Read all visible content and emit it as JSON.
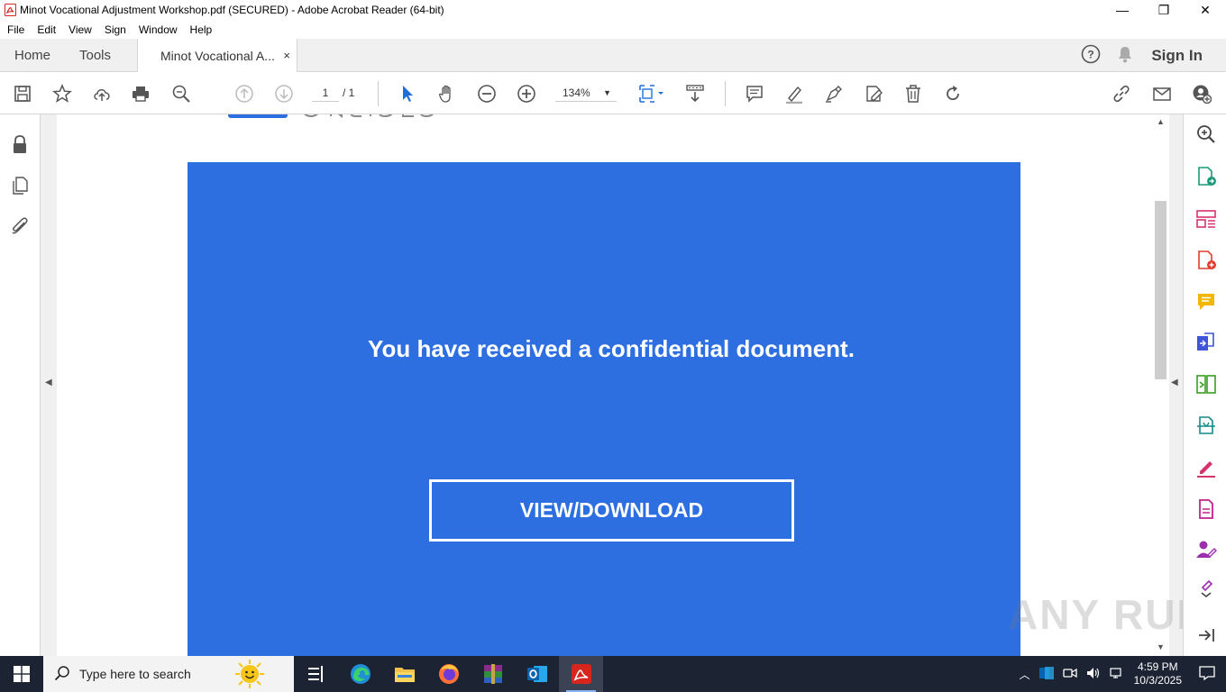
{
  "window": {
    "title": "Minot Vocational Adjustment Workshop.pdf (SECURED) - Adobe Acrobat Reader (64-bit)",
    "minimize": "—",
    "maximize": "❐",
    "close": "✕"
  },
  "menu": [
    "File",
    "Edit",
    "View",
    "Sign",
    "Window",
    "Help"
  ],
  "tabs": {
    "home": "Home",
    "tools": "Tools",
    "document": "Minot Vocational A...",
    "close": "×",
    "sign_in": "Sign In"
  },
  "toolbar": {
    "page_current": "1",
    "page_total": "/ 1",
    "zoom": "134%"
  },
  "document": {
    "headline": "You have received a confidential document.",
    "button": "VIEW/DOWNLOAD",
    "panel_color": "#2d6fe1"
  },
  "watermark": "ANY RUN",
  "taskbar": {
    "search_placeholder": "Type here to search",
    "time": "4:59 PM",
    "date": "10/3/2025"
  },
  "colors": {
    "acrobat_red": "#d7261e",
    "tab_bg": "#f0f0f0",
    "taskbar_bg": "#1c2333"
  }
}
